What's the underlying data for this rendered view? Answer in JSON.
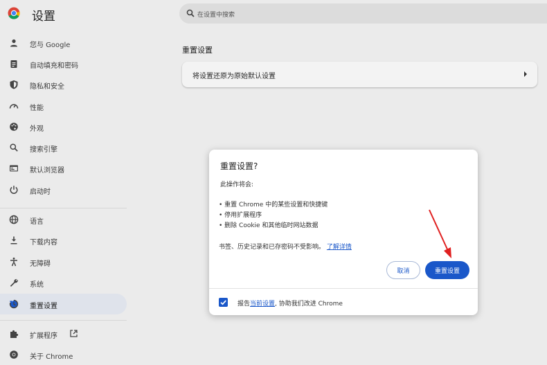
{
  "app": {
    "title": "设置"
  },
  "search": {
    "placeholder": "在设置中搜索"
  },
  "sidebar": {
    "items": [
      {
        "label": "您与 Google",
        "icon": "person-icon"
      },
      {
        "label": "自动填充和密码",
        "icon": "clipboard-icon"
      },
      {
        "label": "隐私和安全",
        "icon": "shield-icon"
      },
      {
        "label": "性能",
        "icon": "speedometer-icon"
      },
      {
        "label": "外观",
        "icon": "palette-icon"
      },
      {
        "label": "搜索引擎",
        "icon": "search-icon"
      },
      {
        "label": "默认浏览器",
        "icon": "browser-icon"
      },
      {
        "label": "启动时",
        "icon": "power-icon"
      },
      {
        "label": "语言",
        "icon": "globe-icon"
      },
      {
        "label": "下载内容",
        "icon": "download-icon"
      },
      {
        "label": "无障碍",
        "icon": "accessibility-icon"
      },
      {
        "label": "系统",
        "icon": "wrench-icon"
      },
      {
        "label": "重置设置",
        "icon": "reset-history-icon",
        "active": true
      },
      {
        "label": "扩展程序",
        "icon": "puzzle-icon"
      },
      {
        "label": "关于 Chrome",
        "icon": "chrome-icon"
      }
    ]
  },
  "main": {
    "section_title": "重置设置",
    "card_label": "将设置还原为原始默认设置"
  },
  "dialog": {
    "title": "重置设置?",
    "subtitle": "此操作将会:",
    "bullets": [
      "• 重置 Chrome 中的某些设置和快捷键",
      "• 停用扩展程序",
      "• 删除 Cookie 和其他临时网站数据"
    ],
    "note_text": "书签、历史记录和已存密码不受影响。",
    "note_link": "了解详情",
    "cancel_label": "取消",
    "reset_label": "重置设置",
    "checkbox_checked": true,
    "checkbox_prefix": "报告",
    "checkbox_link": "当前设置",
    "checkbox_suffix": ", 协助我们改进 Chrome"
  },
  "colors": {
    "accent": "#1a57c9",
    "annotation_arrow": "#e02020"
  }
}
